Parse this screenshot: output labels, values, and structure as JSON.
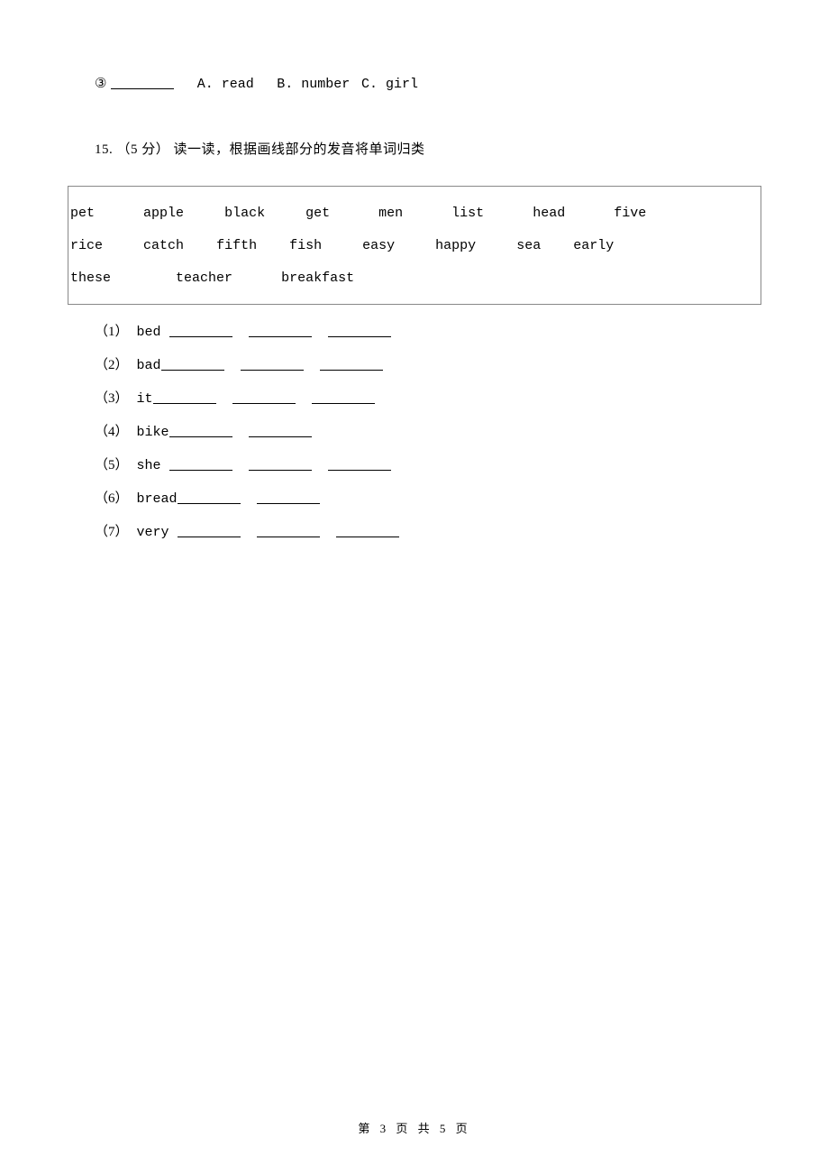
{
  "q14": {
    "circle_num": "③",
    "optA": "A. read",
    "optB": "B. number",
    "optC": "C. girl"
  },
  "q15": {
    "number": "15.",
    "points": "（5 分）",
    "instruction": " 读一读，根据画线部分的发音将单词归类"
  },
  "word_box": {
    "row1": [
      "pet",
      "apple",
      "black",
      "get",
      "men",
      "list",
      "head",
      "five"
    ],
    "row2": [
      "rice",
      "catch",
      "fifth",
      "fish",
      "easy",
      "happy",
      "sea",
      "early"
    ],
    "row3": [
      "these",
      "teacher",
      "breakfast"
    ]
  },
  "subs": {
    "s1": {
      "num": "（1）",
      "word": " bed ",
      "blanks": 3
    },
    "s2": {
      "num": "（2）",
      "word": " bad",
      "blanks": 3
    },
    "s3": {
      "num": "（3）",
      "word": " it",
      "blanks": 3
    },
    "s4": {
      "num": "（4）",
      "word": " bike",
      "blanks": 2
    },
    "s5": {
      "num": "（5）",
      "word": " she ",
      "blanks": 3
    },
    "s6": {
      "num": "（6）",
      "word": " bread",
      "blanks": 2
    },
    "s7": {
      "num": "（7）",
      "word": " very ",
      "blanks": 3
    }
  },
  "footer": "第 3 页 共 5 页"
}
